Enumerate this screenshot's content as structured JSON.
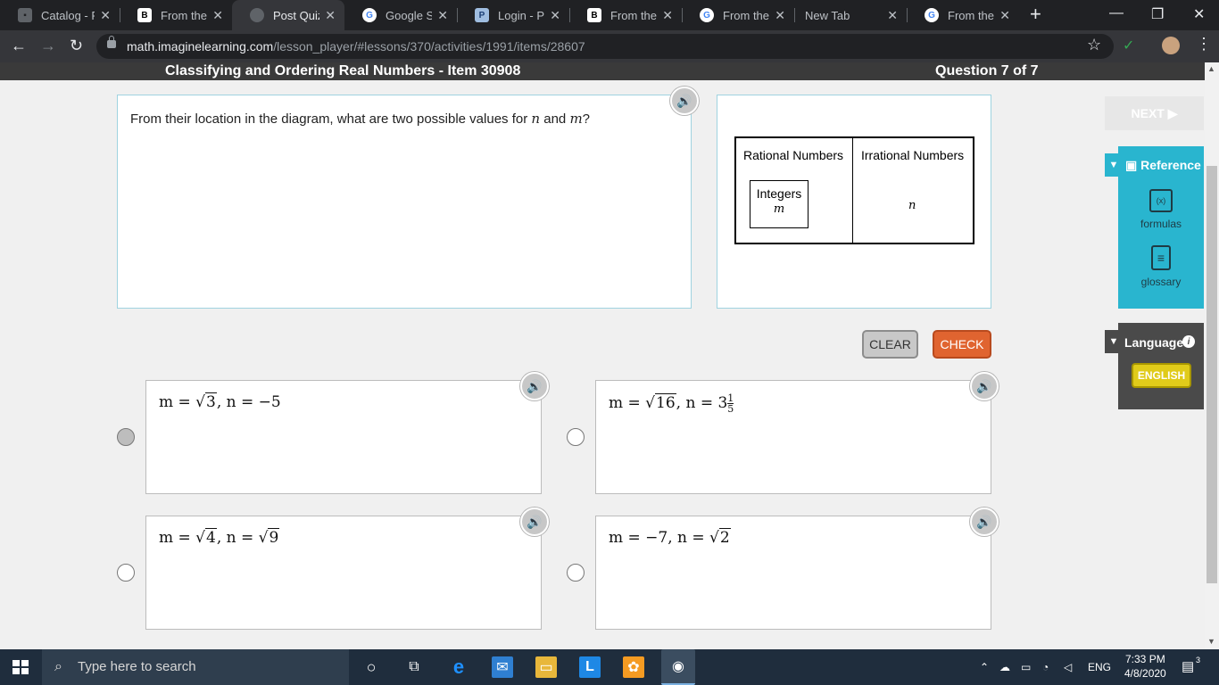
{
  "browser": {
    "tabs": [
      {
        "label": "Catalog - R",
        "icon": "catalog-icon",
        "active": false
      },
      {
        "label": "From their",
        "icon": "brainly-icon",
        "active": false
      },
      {
        "label": "Post Quiz",
        "icon": "loading-icon",
        "active": true
      },
      {
        "label": "Google Sea",
        "icon": "google-icon",
        "active": false
      },
      {
        "label": "Login - Pow",
        "icon": "powerschool-icon",
        "active": false
      },
      {
        "label": "From their",
        "icon": "brainly-icon",
        "active": false
      },
      {
        "label": "From their",
        "icon": "google-icon",
        "active": false
      },
      {
        "label": "New Tab",
        "icon": "",
        "active": false
      },
      {
        "label": "From their",
        "icon": "google-icon",
        "active": false
      }
    ],
    "url_host": "math.imaginelearning.com",
    "url_path": "/lesson_player/#lessons/370/activities/1991/items/28607"
  },
  "header": {
    "title": "Classifying and Ordering Real Numbers - Item 30908",
    "question_counter": "Question 7 of 7"
  },
  "question": {
    "text_before": "From their location in the diagram, what are two possible values for ",
    "var1": "n",
    "text_mid": " and ",
    "var2": "m",
    "text_after": "?"
  },
  "diagram": {
    "rational_label": "Rational Numbers",
    "irrational_label": "Irrational Numbers",
    "integers_label": "Integers",
    "m_label": "m",
    "n_label": "n"
  },
  "buttons": {
    "clear": "CLEAR",
    "check": "CHECK",
    "next": "NEXT ▶"
  },
  "choices": [
    {
      "m_prefix": "m = √",
      "m_rad": "3",
      "n_part": ",  n = −5"
    },
    {
      "m_prefix": "m = √",
      "m_rad": "16",
      "n_part": ",  n = 3",
      "frac_num": "1",
      "frac_den": "5"
    },
    {
      "m_prefix": "m = √",
      "m_rad": "4",
      "n_part": ",  n = √",
      "n_rad": "9"
    },
    {
      "m_prefix": "m = −7,  n = √",
      "m_rad": "2"
    }
  ],
  "reference": {
    "title": "Reference",
    "items": [
      {
        "label": "formulas",
        "icon": "formulas-icon",
        "glyph": "(x)"
      },
      {
        "label": "glossary",
        "icon": "glossary-icon",
        "glyph": "≡"
      }
    ]
  },
  "language": {
    "title": "Language",
    "button": "ENGLISH"
  },
  "taskbar": {
    "search_placeholder": "Type here to search",
    "lang": "ENG",
    "time": "7:33 PM",
    "date": "4/8/2020",
    "notif_count": "3"
  },
  "colors": {
    "check": "#e06430",
    "reference": "#29b5cf",
    "language_button": "#e0cb1a"
  }
}
